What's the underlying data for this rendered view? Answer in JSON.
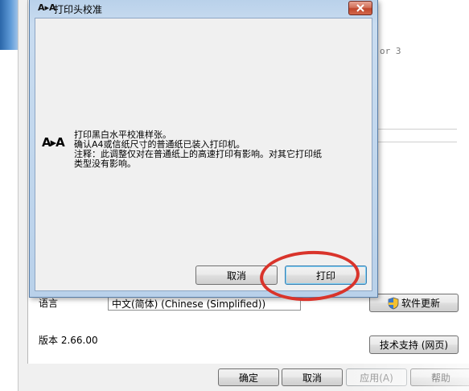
{
  "background_window": {
    "partial_text": "or 3",
    "language_label": "语言",
    "language_select_value": "中文(简体) (Chinese (Simplified))",
    "software_update_label": "软件更新",
    "version_label": "版本 2.66.00",
    "tech_support_label": "技术支持 (网页)",
    "buttons": {
      "ok": "确定",
      "cancel": "取消",
      "apply": "应用(A)",
      "help": "帮助"
    }
  },
  "dialog": {
    "title_icon_text": "A▸A",
    "title": "打印头校准",
    "body_icon_text": "A▸A",
    "message_lines": [
      "打印黑白水平校准样张。",
      "确认A4或信纸尺寸的普通纸已装入打印机。",
      "注释：此调整仅对在普通纸上的高速打印有影响。对其它打印纸",
      "类型没有影响。"
    ],
    "cancel_label": "取消",
    "print_label": "打印"
  },
  "colors": {
    "annotation": "#d9342b",
    "close_button": "#c0462b",
    "title_bar": "#b9d1ea"
  },
  "icons": [
    "close-icon",
    "shield-icon",
    "aa-icon"
  ]
}
